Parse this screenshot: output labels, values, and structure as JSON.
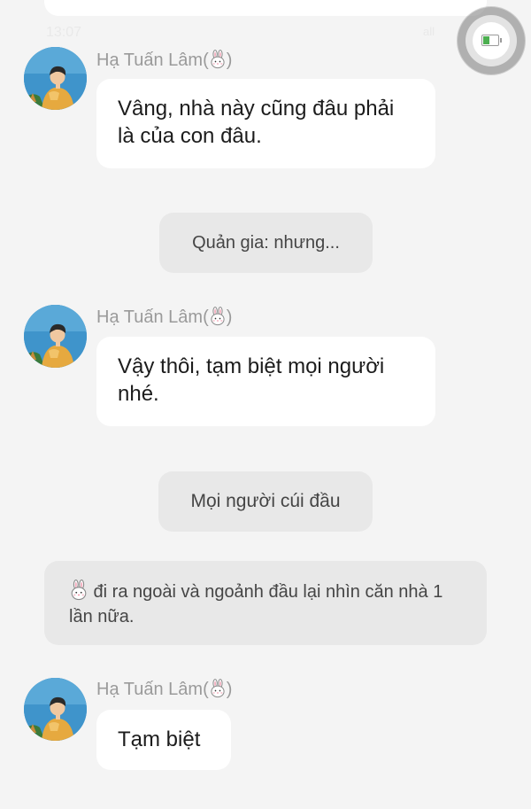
{
  "status_bar": {
    "time": "13:07",
    "signal": "all"
  },
  "messages": [
    {
      "type": "character",
      "name": "Hạ Tuấn Lâm(",
      "name_suffix": ")",
      "icon": "rabbit-icon",
      "avatar": "avatar-icon",
      "text": "Vâng, nhà này cũng đâu phải là của con đâu."
    },
    {
      "type": "system",
      "text": "Quản gia: nhưng..."
    },
    {
      "type": "character",
      "name": "Hạ Tuấn Lâm(",
      "name_suffix": ")",
      "icon": "rabbit-icon",
      "avatar": "avatar-icon",
      "text": "Vậy thôi, tạm biệt mọi người nhé."
    },
    {
      "type": "system",
      "text": "Mọi người cúi đầu"
    },
    {
      "type": "narration",
      "icon": "rabbit-icon",
      "text": " đi ra ngoài và ngoảnh đầu lại nhìn căn nhà 1 lần nữa."
    },
    {
      "type": "character",
      "name": "Hạ Tuấn Lâm(",
      "name_suffix": ")",
      "icon": "rabbit-icon",
      "avatar": "avatar-icon",
      "text": "Tạm biệt"
    }
  ],
  "colors": {
    "background": "#f4f4f4",
    "bubble": "#ffffff",
    "system_bubble": "#e8e8e8",
    "name": "#9a9a9a",
    "battery": "#4caf50"
  }
}
